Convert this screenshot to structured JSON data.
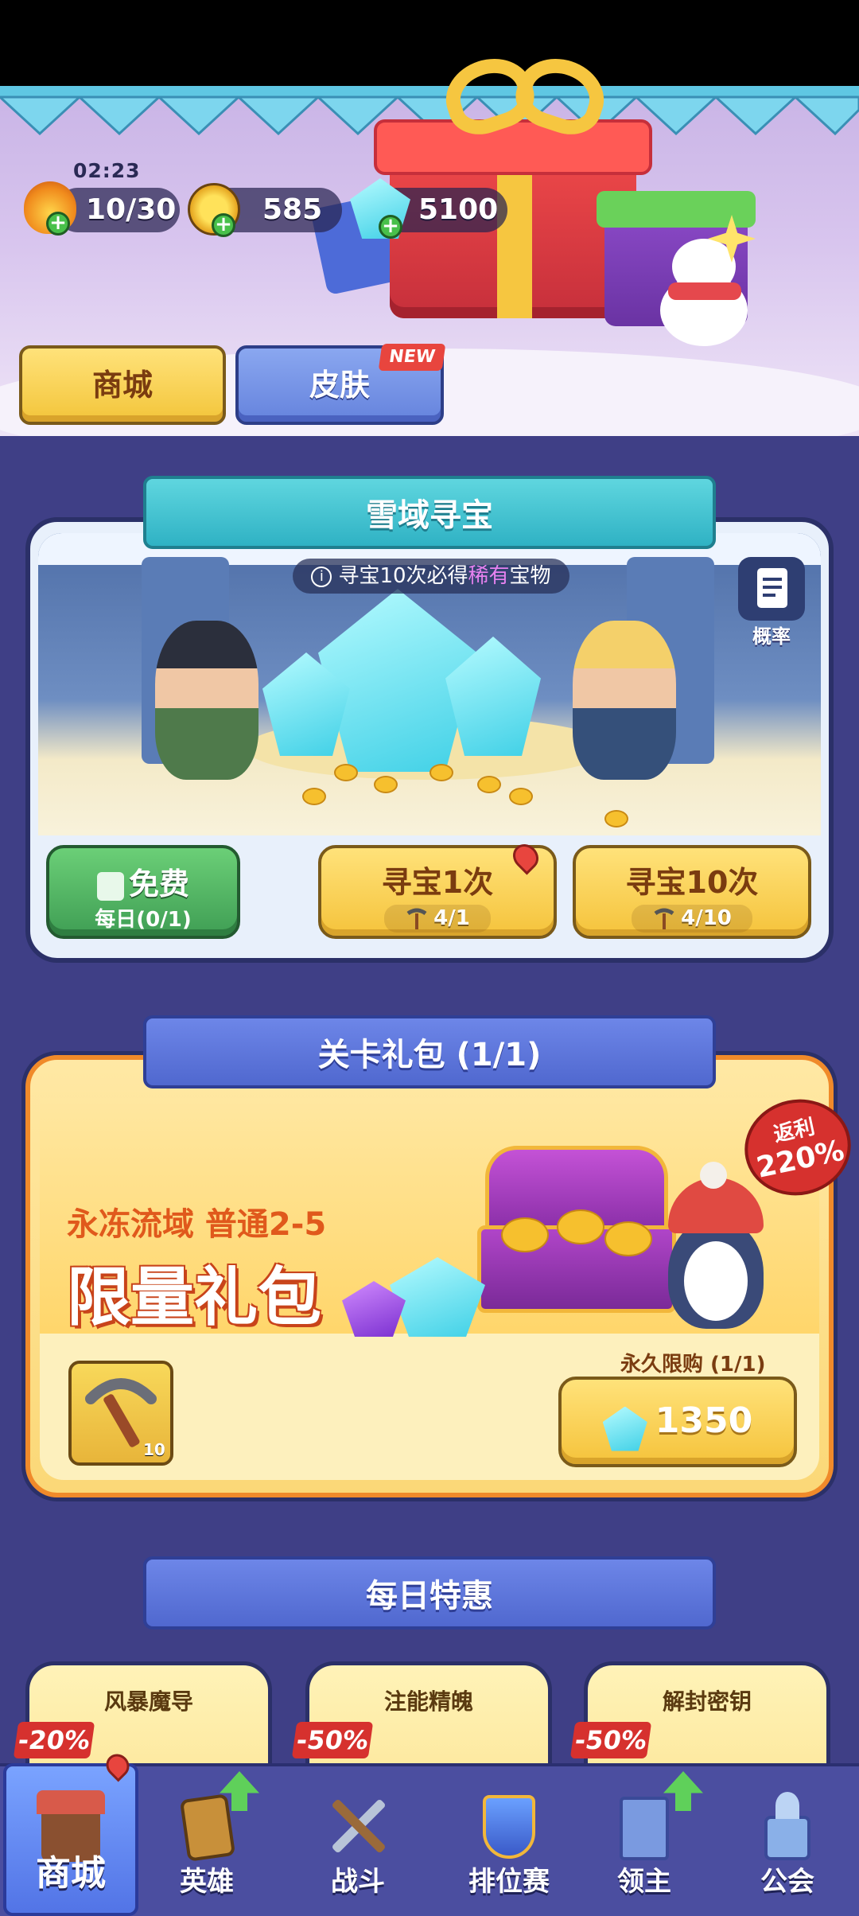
{
  "header": {
    "timer": "02:23",
    "energy": "10/30",
    "gold": "585",
    "gems": "5100"
  },
  "tabs": [
    {
      "label": "商城"
    },
    {
      "label": "皮肤",
      "badge": "NEW"
    }
  ],
  "treasure": {
    "title": "雪域寻宝",
    "notice_prefix": "寻宝10次必得",
    "notice_rare": "稀有",
    "notice_suffix": "宝物",
    "prob_label": "概率",
    "free_title": "免费",
    "free_sub": "每日(0/1)",
    "one_title": "寻宝1次",
    "one_cost": "4/1",
    "ten_title": "寻宝10次",
    "ten_cost": "4/10"
  },
  "pack": {
    "ribbon": "关卡礼包 (1/1)",
    "subtitle": "永冻流域 普通2-5",
    "title": "限量礼包",
    "rebate_label": "返利",
    "rebate_value": "220%",
    "item_count": "10",
    "limit": "永久限购 (1/1)",
    "price": "1350"
  },
  "daily": {
    "ribbon": "每日特惠",
    "deals": [
      {
        "name": "风暴魔导",
        "discount": "-20%"
      },
      {
        "name": "注能精魄",
        "discount": "-50%"
      },
      {
        "name": "解封密钥",
        "discount": "-50%"
      }
    ]
  },
  "nav": [
    {
      "label": "商城"
    },
    {
      "label": "英雄"
    },
    {
      "label": "战斗"
    },
    {
      "label": "排位赛"
    },
    {
      "label": "领主"
    },
    {
      "label": "公会"
    }
  ],
  "colors": {
    "background": "#3f3f86",
    "accent_yellow": "#f5c33b",
    "accent_teal": "#2fb2c4",
    "accent_blue": "#5068cf",
    "rebate_red": "#d6312e"
  }
}
